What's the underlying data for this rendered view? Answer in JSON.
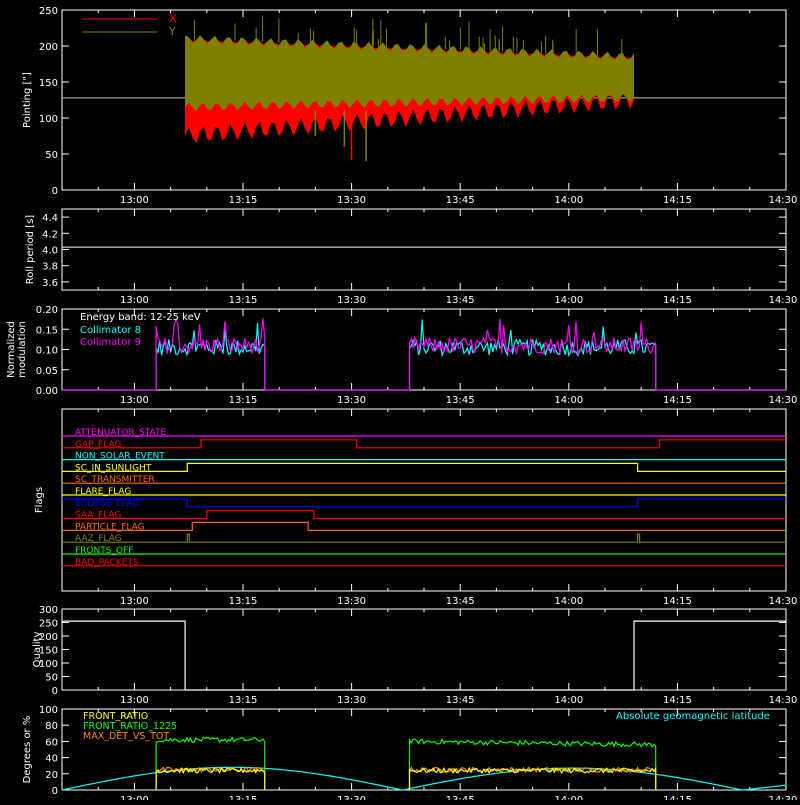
{
  "figure": {
    "background": "#000000",
    "axis_color": "#ffffff"
  },
  "chart_data": [
    {
      "id": "pointing",
      "type": "line",
      "ylabel": "Pointing [\"]",
      "xlim": [
        "12:50",
        "14:30"
      ],
      "ylim": [
        0,
        250
      ],
      "yticks": [
        0,
        50,
        100,
        150,
        200,
        250
      ],
      "xticks": [
        "13:00",
        "13:15",
        "13:30",
        "13:45",
        "14:00",
        "14:15",
        "14:30"
      ],
      "reference_line": 128,
      "series": [
        {
          "name": "X",
          "color": "#ff0000",
          "x_range": [
            "13:07",
            "14:09"
          ],
          "low_start": 75,
          "low_end": 125,
          "high_start": 210,
          "high_end": 185
        },
        {
          "name": "Y",
          "color": "#808000",
          "x_range": [
            "13:07",
            "14:09"
          ],
          "low_start": 115,
          "low_end": 128,
          "high_start": 210,
          "high_end": 185
        }
      ],
      "spikes": [
        {
          "x": "13:25",
          "y": 75,
          "color": "#808000"
        },
        {
          "x": "13:29",
          "y": 60,
          "color": "#808000"
        },
        {
          "x": "13:30",
          "y": 42,
          "color": "#ff0000"
        },
        {
          "x": "13:32",
          "y": 40,
          "color": "#808000"
        }
      ],
      "legend_position": "top-left"
    },
    {
      "id": "roll",
      "type": "line",
      "ylabel": "Roll period [s]",
      "xlim": [
        "12:50",
        "14:30"
      ],
      "ylim": [
        3.5,
        4.5
      ],
      "yticks": [
        3.6,
        3.8,
        4.0,
        4.2,
        4.4
      ],
      "ytick_labels": [
        "3.6",
        "3.8",
        "4.0",
        "4.2",
        "4.4"
      ],
      "xticks": [
        "13:00",
        "13:15",
        "13:30",
        "13:45",
        "14:00",
        "14:15",
        "14:30"
      ],
      "series": [
        {
          "color": "#ffffff",
          "x": [
            "12:50",
            "14:30"
          ],
          "y": [
            4.03,
            4.03
          ]
        }
      ]
    },
    {
      "id": "modulation",
      "type": "line",
      "ylabel": [
        "Normalized",
        "modulation"
      ],
      "xlim": [
        "12:50",
        "14:30"
      ],
      "ylim": [
        0,
        0.2
      ],
      "yticks": [
        0,
        0.05,
        0.1,
        0.15,
        0.2
      ],
      "ytick_labels": [
        "0.00",
        "0.05",
        "0.10",
        "0.15",
        "0.20"
      ],
      "xticks": [
        "13:00",
        "13:15",
        "13:30",
        "13:45",
        "14:00",
        "14:15",
        "14:30"
      ],
      "annotation": "Energy band: 12-25 keV",
      "intervals": [
        [
          "13:03",
          "13:18"
        ],
        [
          "13:38",
          "14:12"
        ]
      ],
      "series": [
        {
          "name": "Collimator 8",
          "color": "#00ffff",
          "mean": 0.105,
          "noise": 0.02
        },
        {
          "name": "Collimator 9",
          "color": "#ff00ff",
          "mean": 0.11,
          "noise": 0.02
        }
      ],
      "legend_position": "top-left"
    },
    {
      "id": "flags",
      "type": "line",
      "ylabel": "Flags",
      "xlim": [
        "12:50",
        "14:30"
      ],
      "xticks": [
        "13:00",
        "13:15",
        "13:30",
        "13:45",
        "14:00",
        "14:15",
        "14:30"
      ],
      "series": [
        {
          "name": "ATTENUATOR_STATE",
          "color": "#ff00ff",
          "transitions": [
            [
              0,
              0
            ]
          ]
        },
        {
          "name": "GAP_FLAG",
          "color": "#ff0000",
          "transitions": [
            [
              0,
              0
            ],
            [
              19.2,
              1
            ],
            [
              40.7,
              0
            ],
            [
              82.5,
              1
            ]
          ]
        },
        {
          "name": "NON_SOLAR_EVENT",
          "color": "#00ffff",
          "transitions": [
            [
              0,
              0
            ]
          ]
        },
        {
          "name": "SC_IN_SUNLIGHT",
          "color": "#ffff00",
          "transitions": [
            [
              0,
              0
            ],
            [
              17.3,
              1
            ],
            [
              79.5,
              0
            ]
          ]
        },
        {
          "name": "SC_TRANSMITTER",
          "color": "#ff6600",
          "transitions": [
            [
              0,
              0
            ]
          ]
        },
        {
          "name": "FLARE_FLAG",
          "color": "#ffff00",
          "transitions": [
            [
              0,
              0
            ]
          ]
        },
        {
          "name": "ECLIPSE_FLAG",
          "color": "#0000ff",
          "transitions": [
            [
              0,
              1
            ],
            [
              17.3,
              0
            ],
            [
              79.5,
              1
            ]
          ]
        },
        {
          "name": "SAA_FLAG",
          "color": "#ff0000",
          "transitions": [
            [
              0,
              0
            ],
            [
              20.0,
              1
            ],
            [
              34.8,
              0
            ]
          ]
        },
        {
          "name": "PARTICLE_FLAG",
          "color": "#ff6600",
          "transitions": [
            [
              0,
              0
            ],
            [
              18.0,
              1
            ],
            [
              34.0,
              0
            ]
          ]
        },
        {
          "name": "AAZ_FLAG",
          "color": "#808000",
          "pulses": [
            17.3,
            79.5
          ]
        },
        {
          "name": "FRONTS_OFF",
          "color": "#00ff00",
          "transitions": [
            [
              0,
              0
            ]
          ]
        },
        {
          "name": "BAD_PACKETS",
          "color": "#ff0000",
          "transitions": [
            [
              0,
              0
            ]
          ]
        }
      ]
    },
    {
      "id": "quality",
      "type": "line",
      "ylabel": "Quality",
      "xlim": [
        "12:50",
        "14:30"
      ],
      "ylim": [
        0,
        300
      ],
      "yticks": [
        0,
        50,
        100,
        150,
        200,
        250,
        300
      ],
      "xticks": [
        "13:00",
        "13:15",
        "13:30",
        "13:45",
        "14:00",
        "14:15",
        "14:30"
      ],
      "series": [
        {
          "color": "#ffffff",
          "points": [
            [
              "12:50",
              255
            ],
            [
              "13:07",
              255
            ],
            [
              "13:07",
              0
            ],
            [
              "14:09",
              0
            ],
            [
              "14:09",
              255
            ],
            [
              "14:30",
              255
            ]
          ]
        }
      ]
    },
    {
      "id": "ratios",
      "type": "line",
      "ylabel": "Degrees or %",
      "xlim": [
        "12:50",
        "14:30"
      ],
      "ylim": [
        0,
        100
      ],
      "yticks": [
        0,
        20,
        40,
        60,
        80,
        100
      ],
      "xticks": [
        "13:00",
        "13:15",
        "13:30",
        "13:45",
        "14:00",
        "14:15",
        "14:30"
      ],
      "intervals": [
        [
          "13:03",
          "13:18"
        ],
        [
          "13:38",
          "14:12"
        ]
      ],
      "series": [
        {
          "name": "FRONT_RATIO",
          "color": "#ffff00",
          "mean": 24,
          "noise": 3
        },
        {
          "name": "FRONT_RATIO_1225",
          "color": "#00ff00",
          "mean_start": 62,
          "mean_end": 58,
          "noise": 3
        },
        {
          "name": "MAX_DET_VS_TOT",
          "color": "#ff8800",
          "mean": 25,
          "noise": 3
        },
        {
          "name": "Absolute geomagnetic latitude",
          "color": "#00ffff",
          "zeros": [
            "12:50",
            "13:37",
            "14:24"
          ],
          "peaks": [
            [
              "13:13",
              28
            ],
            [
              "14:01",
              27
            ]
          ]
        }
      ],
      "legend_position": "top"
    }
  ]
}
